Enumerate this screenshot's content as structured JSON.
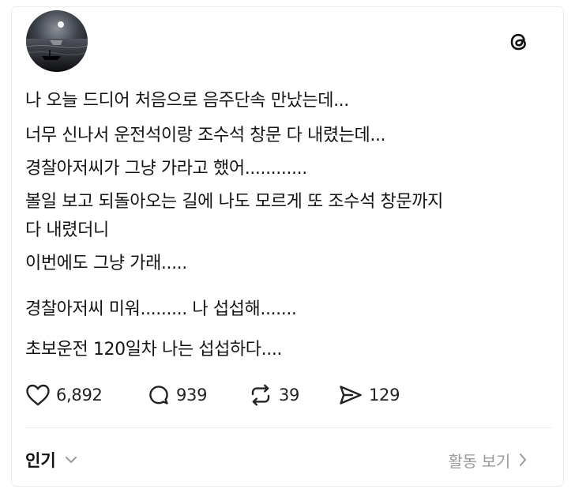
{
  "post": {
    "username": "",
    "lines": [
      "나 오늘 드디어 처음으로 음주단속 만났는데...",
      "너무 신나서 운전석이랑 조수석 창문 다 내렸는데...",
      "경찰아저씨가 그냥 가라고 했어............",
      "볼일 보고 되돌아오는 길에 나도 모르게 또 조수석 창문까지",
      "다 내렸더니",
      "이번에도 그냥 가래.....",
      "경찰아저씨 미워......... 나 섭섭해.......",
      "초보운전 120일차 나는 섭섭하다...."
    ]
  },
  "actions": {
    "likes": "6,892",
    "comments": "939",
    "reposts": "39",
    "shares": "129"
  },
  "footer": {
    "sort_label": "인기",
    "activity_label": "활동 보기"
  },
  "icons": {
    "logo": "threads-logo-icon",
    "like": "heart-icon",
    "comment": "comment-bubble-icon",
    "repost": "repost-icon",
    "share": "send-icon",
    "sort": "chevron-down-icon",
    "activity": "chevron-right-icon"
  },
  "colors": {
    "text": "#141414",
    "muted": "#9a9a9a",
    "divider": "#ededed"
  }
}
